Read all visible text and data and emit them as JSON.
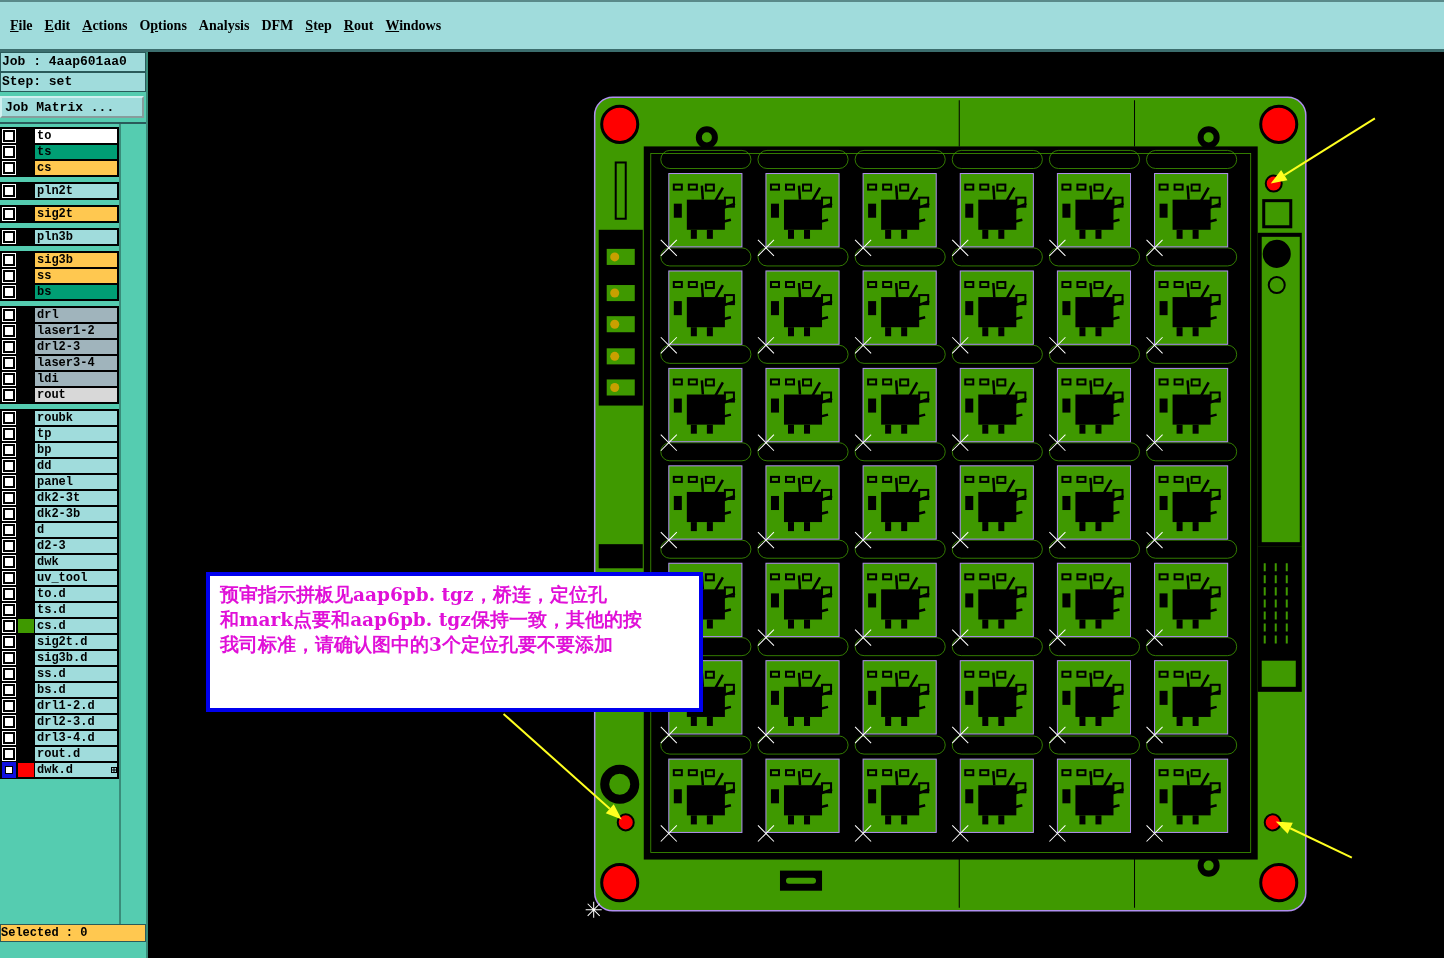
{
  "menu": [
    {
      "key": "F",
      "after": "ile"
    },
    {
      "key": "E",
      "after": "dit"
    },
    {
      "key": "A",
      "after": "ctions"
    },
    {
      "before": "O",
      "key": "p",
      "after": "tions"
    },
    {
      "before": "Analysis"
    },
    {
      "before": "DFM"
    },
    {
      "key": "S",
      "after": "tep"
    },
    {
      "key": "R",
      "after": "out"
    },
    {
      "key": "W",
      "after": "indows"
    }
  ],
  "job": "Job : 4aap601aa0",
  "step": "Step: set",
  "job_matrix_button": "Job Matrix ...",
  "layer_groups": [
    [
      {
        "name": "to",
        "color": "#ffffff",
        "selected": false
      },
      {
        "name": "ts",
        "color": "#009e74",
        "selected": false
      },
      {
        "name": "cs",
        "color": "#ffc850",
        "selected": false
      }
    ],
    [
      {
        "name": "pln2t",
        "color": "#a0dcdc",
        "selected": false
      }
    ],
    [
      {
        "name": "sig2t",
        "color": "#ffc850",
        "selected": false
      }
    ],
    [
      {
        "name": "pln3b",
        "color": "#a0dcdc",
        "selected": false
      }
    ],
    [
      {
        "name": "sig3b",
        "color": "#ffc850",
        "selected": false
      },
      {
        "name": "ss",
        "color": "#ffc850",
        "selected": false
      },
      {
        "name": "bs",
        "color": "#009e74",
        "selected": false
      }
    ],
    [
      {
        "name": "drl",
        "color": "#a0b4bc",
        "selected": false
      },
      {
        "name": "laser1-2",
        "color": "#a0b4bc",
        "selected": false
      },
      {
        "name": "drl2-3",
        "color": "#a0b4bc",
        "selected": false
      },
      {
        "name": "laser3-4",
        "color": "#a0b4bc",
        "selected": false
      },
      {
        "name": "ldi",
        "color": "#a0b4bc",
        "selected": false
      },
      {
        "name": "rout",
        "color": "#d8d8d8",
        "selected": false
      }
    ],
    [
      {
        "name": "roubk",
        "color": "#a0dcdc",
        "selected": false
      },
      {
        "name": "tp",
        "color": "#a0dcdc",
        "selected": false
      },
      {
        "name": "bp",
        "color": "#a0dcdc",
        "selected": false
      },
      {
        "name": "dd",
        "color": "#a0dcdc",
        "selected": false
      },
      {
        "name": "panel",
        "color": "#a0dcdc",
        "selected": false
      },
      {
        "name": "dk2-3t",
        "color": "#a0dcdc",
        "selected": false
      },
      {
        "name": "dk2-3b",
        "color": "#a0dcdc",
        "selected": false
      },
      {
        "name": "d",
        "color": "#a0dcdc",
        "selected": false
      },
      {
        "name": "d2-3",
        "color": "#a0dcdc",
        "selected": false
      },
      {
        "name": "dwk",
        "color": "#a0dcdc",
        "selected": false
      },
      {
        "name": "uv_tool",
        "color": "#a0dcdc",
        "selected": false
      },
      {
        "name": "to.d",
        "color": "#a0dcdc",
        "selected": false
      },
      {
        "name": "ts.d",
        "color": "#a0dcdc",
        "selected": false
      },
      {
        "name": "cs.d",
        "color": "#a0dcdc",
        "swatch": {
          "color": "#3f9900"
        },
        "selected": false
      },
      {
        "name": "sig2t.d",
        "color": "#a0dcdc",
        "selected": false
      },
      {
        "name": "sig3b.d",
        "color": "#a0dcdc",
        "selected": false
      },
      {
        "name": "ss.d",
        "color": "#a0dcdc",
        "selected": false
      },
      {
        "name": "bs.d",
        "color": "#a0dcdc",
        "selected": false
      },
      {
        "name": "drl1-2.d",
        "color": "#a0dcdc",
        "selected": false
      },
      {
        "name": "drl2-3.d",
        "color": "#a0dcdc",
        "selected": false
      },
      {
        "name": "drl3-4.d",
        "color": "#a0dcdc",
        "selected": false
      },
      {
        "name": "rout.d",
        "color": "#a0dcdc",
        "selected": false
      },
      {
        "name": "dwk.d",
        "color": "#a0dcdc",
        "swatch": {
          "color": "#ff0000"
        },
        "selected": true
      }
    ]
  ],
  "status": "Selected : 0",
  "note": {
    "lines": [
      "预审指示拼板见aap6pb. tgz，桥连，定位孔",
      "和mark点要和aap6pb. tgz保持一致，其他的按",
      "我司标准，请确认图中的3个定位孔要不要添加"
    ]
  }
}
